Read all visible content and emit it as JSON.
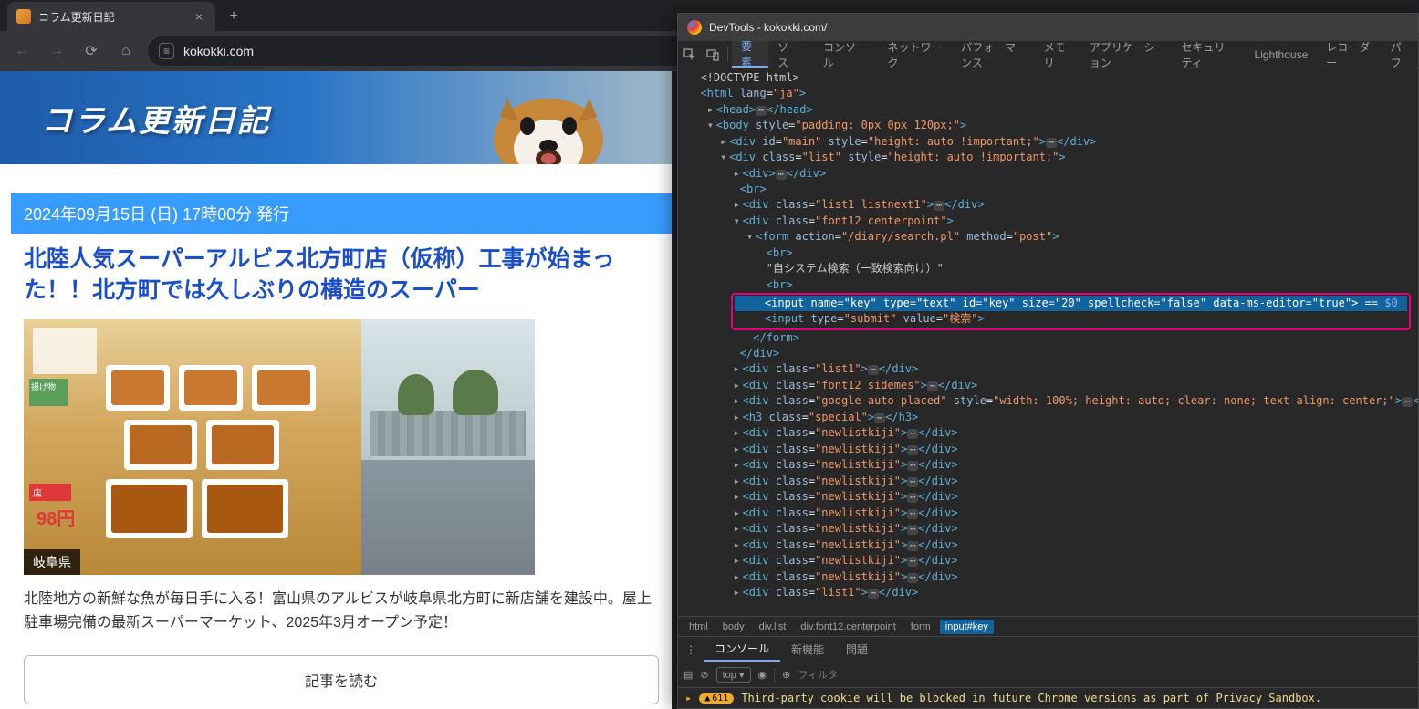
{
  "browser": {
    "tab_title": "コラム更新日記",
    "url": "kokokki.com"
  },
  "win_controls": {
    "min": "—",
    "max": "□",
    "close": "×"
  },
  "page": {
    "banner_title": "コラム更新日記",
    "date_line": "2024年09月15日 (日) 17時00分 発行",
    "headline": "北陸人気スーパーアルビス北方町店（仮称）工事が始まった！！北方町では久しぶりの構造のスーパー",
    "img_badge": "岐阜県",
    "body": "北陸地方の新鮮な魚が毎日手に入る！富山県のアルビスが岐阜県北方町に新店舗を建設中。屋上駐車場完備の最新スーパーマーケット、2025年3月オープン予定！",
    "read_more": "記事を読む",
    "price_sign": "98円",
    "shelf_sign": "揚げ物"
  },
  "devtools": {
    "title": "DevTools - kokokki.com/",
    "tabs": [
      "要素",
      "ソース",
      "コンソール",
      "ネットワーク",
      "パフォーマンス",
      "メモリ",
      "アプリケーション",
      "セキュリティ",
      "Lighthouse",
      "レコーダー",
      "パフ"
    ],
    "active_tab": 0,
    "elements": {
      "doctype": "<!DOCTYPE html>",
      "html_lang": "ja",
      "body_style": "padding: 0px 0px 120px;",
      "main_style": "height: auto !important;",
      "list_style": "height: auto !important;",
      "list1_class": "list1 listnext1",
      "font12_class": "font12 centerpoint",
      "form_action": "/diary/search.pl",
      "form_method": "post",
      "search_text": "\"自システム検索（一致検索向け）\"",
      "input_line": "<input name=\"key\" type=\"text\" id=\"key\" size=\"20\" spellcheck=\"false\" data-ms-editor=\"true\"> ==",
      "input_tail": "$0",
      "submit_value": "検索",
      "rest": [
        {
          "class": "list1"
        },
        {
          "class": "font12 sidemes"
        },
        {
          "class": "google-auto-placed",
          "style": "width: 100%; height: auto; clear: none; text-align: center;"
        },
        {
          "tag": "h3",
          "class": "special"
        },
        {
          "class": "newlistkiji"
        },
        {
          "class": "newlistkiji"
        },
        {
          "class": "newlistkiji"
        },
        {
          "class": "newlistkiji"
        },
        {
          "class": "newlistkiji"
        },
        {
          "class": "newlistkiji"
        },
        {
          "class": "newlistkiji"
        },
        {
          "class": "newlistkiji"
        },
        {
          "class": "newlistkiji"
        },
        {
          "class": "newlistkiji"
        },
        {
          "class": "list1"
        }
      ]
    },
    "crumbs": [
      "html",
      "body",
      "div.list",
      "div.font12.centerpoint",
      "form",
      "input#key"
    ],
    "drawer_tabs": [
      "コンソール",
      "新機能",
      "問題"
    ],
    "filter_placeholder": "フィルタ",
    "top_label": "top ▾",
    "warn_count": "611",
    "console_warning": "Third-party cookie will be blocked in future Chrome versions as part of Privacy Sandbox."
  }
}
